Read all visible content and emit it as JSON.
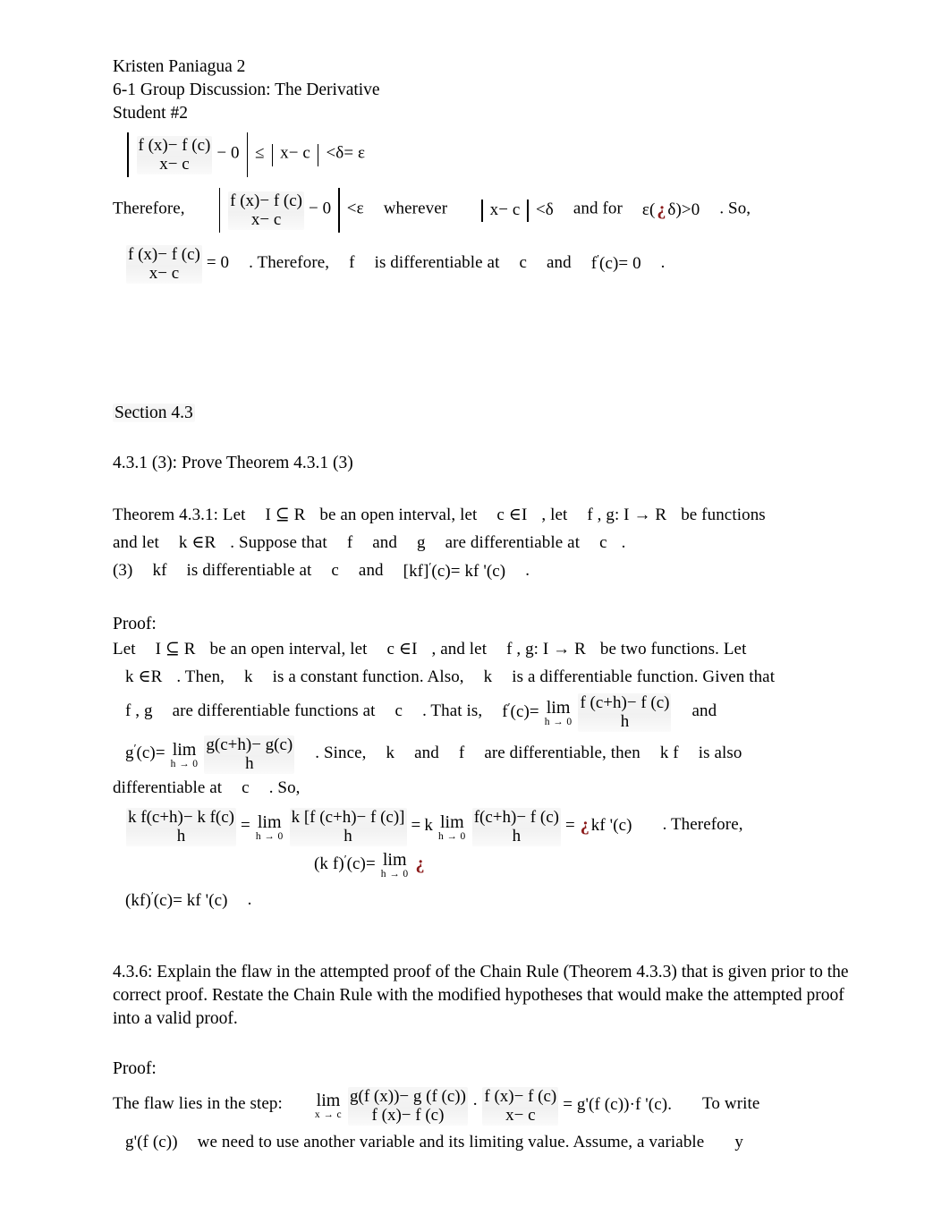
{
  "document": {
    "header": {
      "student_name": "Kristen Paniagua 2",
      "assignment": "6-1 Group Discussion: The Derivative",
      "student_label": "Student #2"
    },
    "error_glyph": "¿",
    "error_color": "#8B1A1A",
    "eq1": {
      "num": "f (x)− f (c)",
      "den": "x− c",
      "minus_zero": "− 0",
      "rel": "≤",
      "abs_inner": "x− c",
      "tail": "<δ= ε"
    },
    "therefore_line": {
      "lead": "Therefore,",
      "num": "f (x)− f (c)",
      "den": "x− c",
      "minus_zero": "− 0",
      "lt_eps": "<ε",
      "wherever": "wherever",
      "abs_inner": "x− c",
      "lt_delta": "<δ",
      "and_for": "and for",
      "eps_open": "ε(",
      "eps_close": "δ)>0",
      "so": ". So,"
    },
    "eq2": {
      "num": "f (x)− f (c)",
      "den": "x− c",
      "equals_zero": "= 0",
      "therefore": ". Therefore,",
      "f": "f",
      "is_diff_at": "is differentiable at",
      "c": "c",
      "and": "and",
      "fprime": "f",
      "fprime_tail": "(c)= 0",
      "period": "."
    },
    "section_heading": "Section 4.3",
    "problem_431": "4.3.1 (3): Prove Theorem 4.3.1 (3)",
    "theorem": {
      "line1_a": "Theorem 4.3.1: Let",
      "line1_I": "I ⊆ R",
      "line1_b": "be an open interval, let",
      "line1_c": "c ∈I",
      "line1_d": ", let",
      "line1_fg": "f , g: I → R",
      "line1_e": "be functions",
      "line2_a": "and let",
      "line2_k": "k ∈R",
      "line2_b": ". Suppose that",
      "line2_f": "f",
      "line2_and": "and",
      "line2_g": "g",
      "line2_c": "are differentiable at",
      "line2_d": "c",
      "line2_e": ".",
      "line3_a": "(3)",
      "line3_kf": "kf",
      "line3_b": "is differentiable at",
      "line3_c": "c",
      "line3_and": "and",
      "line3_brk": "[kf]",
      "line3_d": "(c)= kf '(c)",
      "line3_e": "."
    },
    "proof_label": "Proof:",
    "proof_431": {
      "line1_a": "Let",
      "line1_I": "I ⊆ R",
      "line1_b": "be an open interval, let",
      "line1_c": "c ∈I",
      "line1_d": ", and let",
      "line1_fg": "f , g: I → R",
      "line1_e": "be two functions. Let",
      "line2_k": "k ∈R",
      "line2_a": ". Then,",
      "line2_k2": "k",
      "line2_b": "is a constant function. Also,",
      "line2_k3": "k",
      "line2_c": "is a differentiable function. Given that",
      "line3_fg": "f , g",
      "line3_a": "are differentiable functions at",
      "line3_c": "c",
      "line3_b": ". That is,",
      "line3_fprime": "f",
      "line3_fprime_tail": "(c)=",
      "lim_op": "lim",
      "lim_sub": "h → 0",
      "line3_num": "f (c+h)− f (c)",
      "line3_den": "h",
      "line3_and": "and",
      "line4_gprime": "g",
      "line4_gprime_tail": "(c)=",
      "line4_num": "g(c+h)− g(c)",
      "line4_den": "h",
      "line4_a": ". Since,",
      "line4_k": "k",
      "line4_and": "and",
      "line4_f": "f",
      "line4_b": "are differentiable, then",
      "line4_kf": "k f",
      "line4_c": "is also",
      "line5_a": "differentiable at",
      "line5_c": "c",
      "line5_b": ". So,"
    },
    "eq_chain": {
      "f1_num": "k f(c+h)− k f(c)",
      "f1_den": "h",
      "eq1": "=",
      "f2_num": "k [f (c+h)− f (c)]",
      "f2_den": "h",
      "eq2": "=",
      "k": "k",
      "f3_num": "f(c+h)− f (c)",
      "f3_den": "h",
      "eq3": "=",
      "result": "kf '(c)",
      "therefore": ". Therefore,",
      "second_lhs_a": "(k f",
      "second_lhs_b": "(c)=",
      "lim_op": "lim",
      "lim_sub": "h → 0",
      "final_lhs": "(kf)",
      "final_rhs": "(c)= kf '(c)",
      "final_period": "."
    },
    "problem_436": "4.3.6: Explain the flaw in the attempted proof of the Chain Rule (Theorem 4.3.3) that is given prior to the correct proof. Restate the Chain Rule with the modified hypotheses that would make the attempted proof into a valid proof.",
    "proof_436": {
      "lead": "The flaw lies in the step:",
      "lim_op": "lim",
      "lim_sub": "x → c",
      "f1_num": "g(f (x))− g (f (c))",
      "f1_den": "f (x)− f (c)",
      "dot": "·",
      "f2_num": "f (x)− f (c)",
      "f2_den": "x− c",
      "rhs": "= g'(f (c))·f '(c).",
      "tail": "To write",
      "line2_a": "g'(f (c))",
      "line2_b": "we need to use another variable and its limiting value. Assume, a variable",
      "line2_y": "y"
    }
  }
}
